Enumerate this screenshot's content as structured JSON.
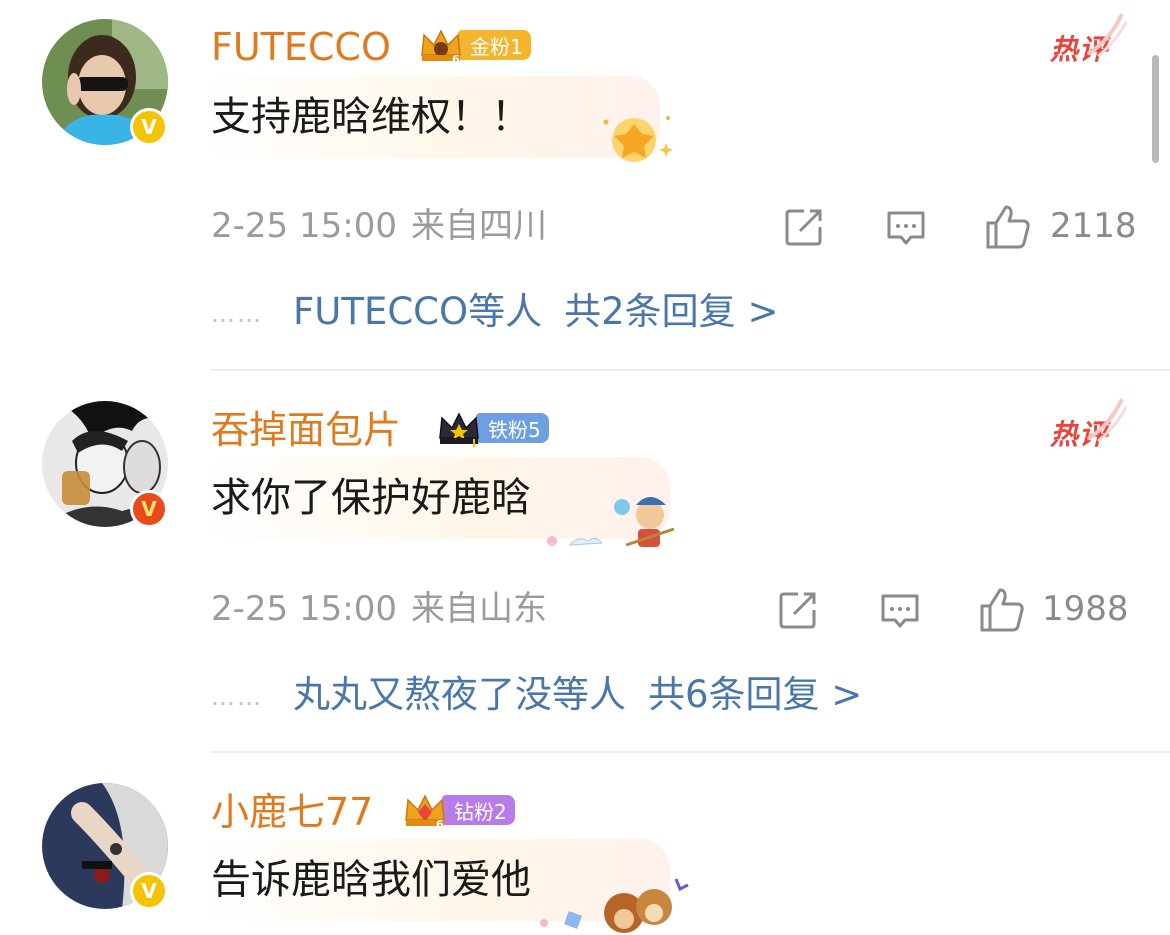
{
  "hot_label": "热评",
  "comments": [
    {
      "username": "FUTECCO",
      "fan_badge": {
        "level_digit": "6",
        "label": "金粉1",
        "color": "#f3b52e"
      },
      "text": "支持鹿晗维权！！",
      "time": "2-25 15:00",
      "location": "来自四川",
      "likes": "2118",
      "replies": {
        "dots": "……",
        "who": "FUTECCO等人",
        "summary": "共2条回复 >"
      }
    },
    {
      "username": "吞掉面包片",
      "fan_badge": {
        "level_digit": "I",
        "label": "铁粉5",
        "color": "#6f9fe3"
      },
      "text": "求你了保护好鹿晗",
      "time": "2-25 15:00",
      "location": "来自山东",
      "likes": "1988",
      "replies": {
        "dots": "……",
        "who": "丸丸又熬夜了没等人",
        "summary": "共6条回复 >"
      }
    },
    {
      "username": "小鹿七77",
      "fan_badge": {
        "level_digit": "6",
        "label": "钻粉2",
        "color": "#b77ce8"
      },
      "text": "告诉鹿晗我们爱他"
    }
  ],
  "colors": {
    "username": "#e07a1f",
    "reply_link": "#4a77aa",
    "hot": "#e8453c",
    "meta": "#9b9b9b"
  }
}
